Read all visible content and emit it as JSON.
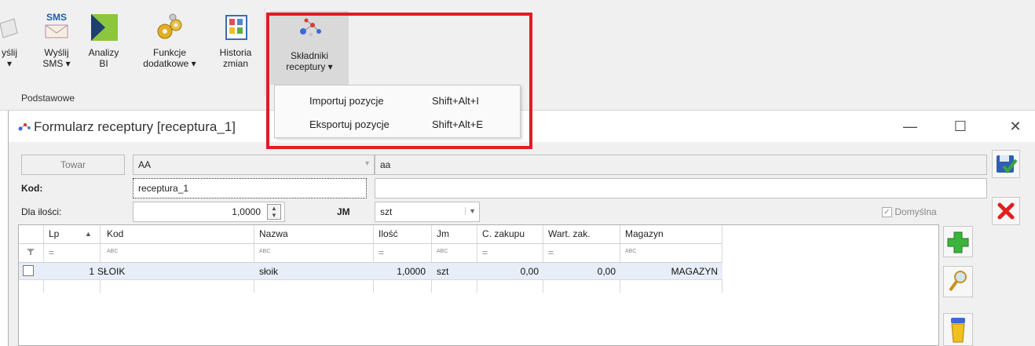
{
  "ribbon": {
    "buttons": [
      {
        "label": "yślij\n▾"
      },
      {
        "label": "Wyślij\nSMS ▾",
        "icon_text": "SMS"
      },
      {
        "label": "Analizy\nBI"
      },
      {
        "label": "Funkcje\ndodatkowe ▾"
      },
      {
        "label": "Historia\nzmian"
      },
      {
        "label": "Składniki\nreceptury ▾"
      }
    ],
    "group_label": "Podstawowe"
  },
  "menu": {
    "items": [
      {
        "label": "Importuj pozycje",
        "shortcut": "Shift+Alt+I"
      },
      {
        "label": "Eksportuj pozycje",
        "shortcut": "Shift+Alt+E"
      }
    ]
  },
  "window": {
    "title": "Formularz receptury [receptura_1]",
    "minimize": "—",
    "maximize": "☐",
    "close": "✕"
  },
  "form": {
    "towar_label": "Towar",
    "towar_code": "AA",
    "towar_name": "aa",
    "kod_label": "Kod:",
    "kod_value": "receptura_1",
    "kod_extra": "",
    "dla_ilosci_label": "Dla ilości:",
    "dla_ilosci_value": "1,0000",
    "jm_label": "JM",
    "jm_value": "szt",
    "domyslna_label": "Domyślna",
    "domyslna_checked": true
  },
  "grid": {
    "columns": [
      "Lp",
      "Kod",
      "Nazwa",
      "Ilość",
      "Jm",
      "C. zakupu",
      "Wart. zak.",
      "Magazyn"
    ],
    "filter_row": [
      "",
      "=",
      "ABC",
      "ABC",
      "=",
      "ABC",
      "=",
      "=",
      "ABC"
    ],
    "rows": [
      {
        "lp": "1",
        "kod": "SŁOIK",
        "nazwa": "słoik",
        "ilosc": "1,0000",
        "jm": "szt",
        "c_zakupu": "0,00",
        "wart_zak": "0,00",
        "magazyn": "MAGAZYN"
      }
    ]
  },
  "colors": {
    "highlight": "#e31b23",
    "ribbon_bg": "#f0f0f0",
    "row_selected": "#e8eef8"
  }
}
